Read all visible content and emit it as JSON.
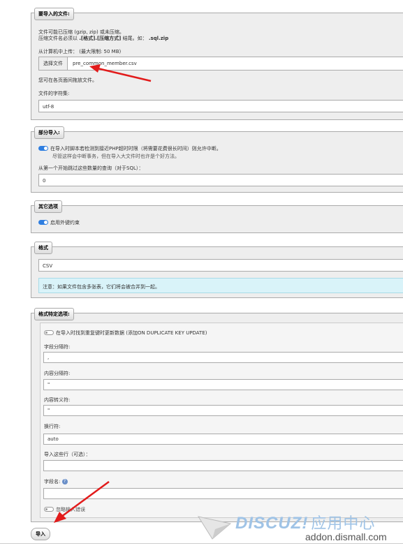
{
  "file_section": {
    "legend": "要导入的文件:",
    "line1": "文件可能已压缩 (gzip, zip) 或未压缩。",
    "line2_a": "压缩文件名必须以",
    "line2_b": ".[格式].[压缩方式]",
    "line2_c": "结尾。如：",
    "line2_d": ".sql.zip",
    "upload_label": "从计算机中上传：",
    "upload_limit": "(最大限制: 50 MB)",
    "choose_button": "选择文件",
    "file_name": "pre_common_member.csv",
    "drag_hint": "您可在各页面间拖放文件。",
    "charset_label": "文件的字符集:",
    "charset_value": "utf-8"
  },
  "partial_section": {
    "legend": "部分导入:",
    "interrupt_label": "在导入时脚本若检测到接近PHP超时时限（将需要花费很长时间）则允许中断。",
    "interrupt_sub": "尽管这样会中断事务，但在导入大文件时也许是个好方法。",
    "skip_label": "从第一个开始跳过这些数量的查询（对于SQL）：",
    "skip_value": "0"
  },
  "other_section": {
    "legend": "其它选项",
    "fk_label": "启用外键约束"
  },
  "format_section": {
    "legend": "格式",
    "format_value": "CSV",
    "note": "注意：如果文件包含多张表，它们将会被合并到一起。"
  },
  "specific_section": {
    "legend": "格式特定选项:",
    "update_label": "在导入时找到重复键时更新数据 (添加ON DUPLICATE KEY UPDATE)",
    "field_sep_label": "字段分隔符:",
    "field_sep_value": ",",
    "enclosed_label": "内容分隔符:",
    "enclosed_value": "\"",
    "escaped_label": "内容转义符:",
    "escaped_value": "\"",
    "line_term_label": "换行符:",
    "line_term_value": "auto",
    "ignore_lines_label": "导入这些行（可选）：",
    "ignore_lines_value": "",
    "column_names_label": "字段名:",
    "column_names_value": "",
    "last_label": "忽略输入错误"
  },
  "submit_label": "导入",
  "watermark": {
    "brand": "DISCUZ!",
    "cn": "应用中心",
    "url": "addon.dismall.com"
  },
  "colors": {
    "arrow": "#e21b1b",
    "toggle_on": "#2f7ee0",
    "note_bg": "#d9f3f9",
    "watermark": "#1e73be"
  }
}
